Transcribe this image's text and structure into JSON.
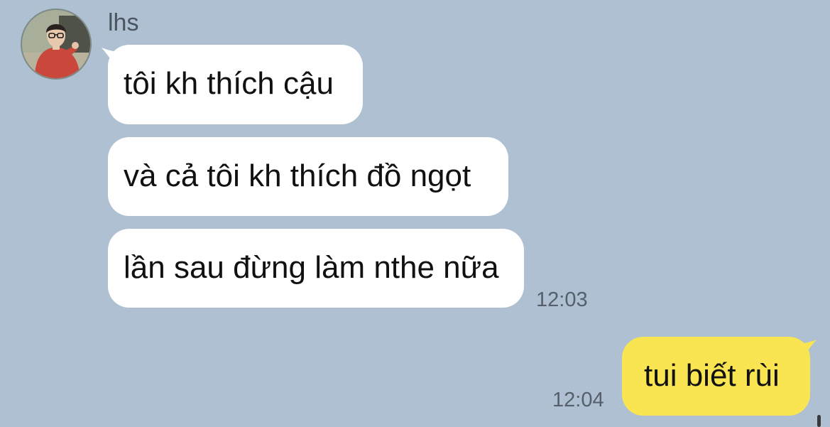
{
  "contact": {
    "name": "lhs",
    "avatar_icon": "profile-photo"
  },
  "messages": [
    {
      "direction": "incoming",
      "text": "tôi kh thích cậu"
    },
    {
      "direction": "incoming",
      "text": "và cả tôi kh thích đồ ngọt"
    },
    {
      "direction": "incoming",
      "text": "lần sau đừng làm nthe nữa",
      "time": "12:03"
    },
    {
      "direction": "outgoing",
      "text": "tui biết rùi",
      "time": "12:04"
    }
  ],
  "colors": {
    "background": "#aec0d2",
    "incoming_bubble": "#ffffff",
    "outgoing_bubble": "#f9e451",
    "timestamp_text": "#56606a"
  }
}
